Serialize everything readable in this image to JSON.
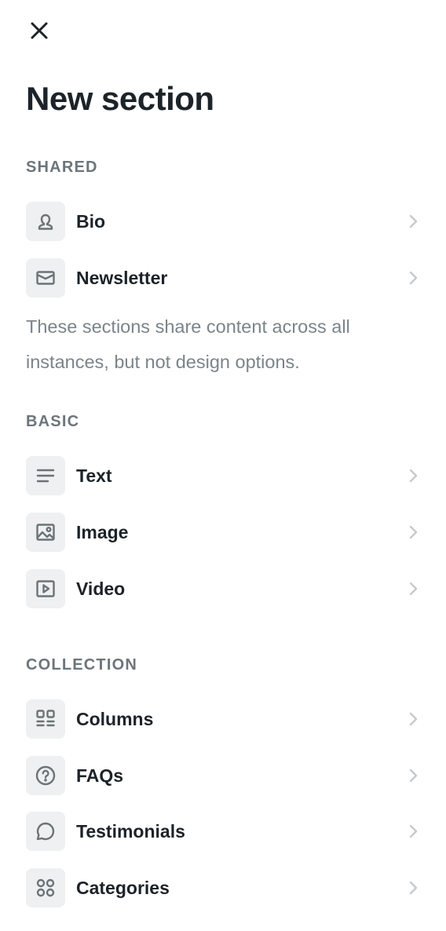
{
  "header": {
    "close_icon": "close-icon",
    "title": "New section"
  },
  "shared": {
    "heading": "SHARED",
    "items": [
      {
        "label": "Bio",
        "icon": "person-icon"
      },
      {
        "label": "Newsletter",
        "icon": "envelope-icon"
      }
    ],
    "note": "These sections share content across all instances, but not design options."
  },
  "basic": {
    "heading": "BASIC",
    "items": [
      {
        "label": "Text",
        "icon": "text-lines-icon"
      },
      {
        "label": "Image",
        "icon": "image-icon"
      },
      {
        "label": "Video",
        "icon": "video-play-icon"
      }
    ]
  },
  "collection": {
    "heading": "COLLECTION",
    "items": [
      {
        "label": "Columns",
        "icon": "columns-icon"
      },
      {
        "label": "FAQs",
        "icon": "question-circle-icon"
      },
      {
        "label": "Testimonials",
        "icon": "chat-bubble-icon"
      },
      {
        "label": "Categories",
        "icon": "categories-grid-icon"
      }
    ]
  },
  "colors": {
    "text_primary": "#1c2329",
    "text_muted": "#6c757a",
    "icon_bg": "#eef0f1",
    "icon_stroke": "#6b7378",
    "chevron": "#c5cacd"
  }
}
